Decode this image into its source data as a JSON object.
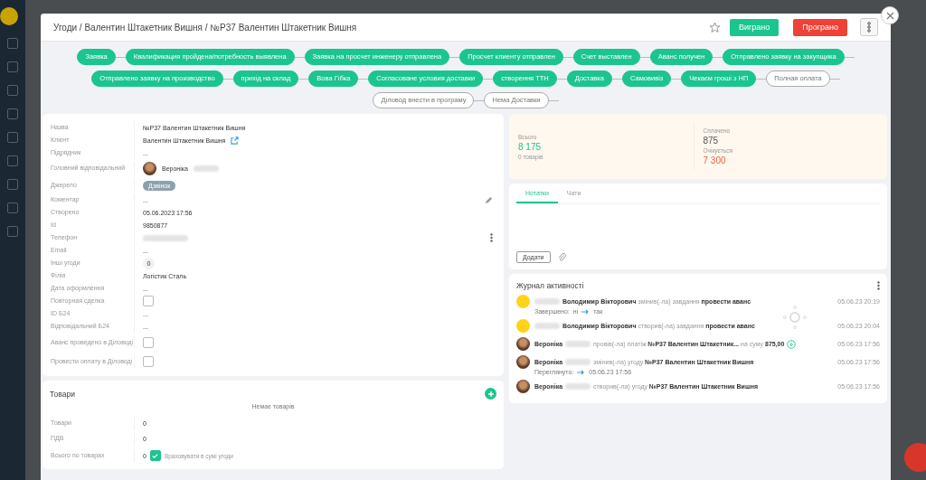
{
  "breadcrumb": "Угоди / Валентин Штакетник Вишня / №Р37 Валентин Штакетник Вишня",
  "header_buttons": [
    {
      "label": "Виграно",
      "kind": "won"
    },
    {
      "label": "Програно",
      "kind": "lost"
    }
  ],
  "stages": [
    {
      "label": "Заявка",
      "done": true
    },
    {
      "label": "Квалификация пройдена/потребность выявлена",
      "done": true
    },
    {
      "label": "Заявка на просчет инженеру отправлена",
      "done": true
    },
    {
      "label": "Просчет клиенту отправлен",
      "done": true
    },
    {
      "label": "Счет выставлен",
      "done": true
    },
    {
      "label": "Аванс получен",
      "done": true
    },
    {
      "label": "Отправлено заявку на закупщика",
      "done": true
    },
    {
      "label": "Отправлено заявку на производство",
      "done": true
    },
    {
      "label": "прихід на склад",
      "done": true
    },
    {
      "label": "Вова Гібка",
      "done": true
    },
    {
      "label": "Согласоване условия доставки",
      "done": true
    },
    {
      "label": "створення ТТН",
      "done": true
    },
    {
      "label": "Доставка",
      "done": true
    },
    {
      "label": "Самовивіз",
      "done": true
    },
    {
      "label": "Чекаєм гроші з НП",
      "done": true
    },
    {
      "label": "Полная оплата",
      "done": false
    },
    {
      "label": "Діловод внести в програму",
      "done": false
    },
    {
      "label": "Нема Доставки",
      "done": false
    }
  ],
  "fields": [
    {
      "label": "Назва",
      "kind": "text",
      "value": "№Р37 Валентин Штакетник Вишня"
    },
    {
      "label": "Клієнт",
      "kind": "link",
      "value": "Валентин Штакетник Вишня"
    },
    {
      "label": "Підрядник",
      "kind": "text",
      "value": "..."
    },
    {
      "label": "Головний відповідальний",
      "kind": "person",
      "value": "Вероніка"
    },
    {
      "label": "Джерело",
      "kind": "badge",
      "value": "Дзвінок"
    },
    {
      "label": "Коментар",
      "kind": "edit",
      "value": "..."
    },
    {
      "label": "Створено",
      "kind": "text",
      "value": "05.06.2023 17:56"
    },
    {
      "label": "Id",
      "kind": "text",
      "value": "9850877"
    },
    {
      "label": "Телефон",
      "kind": "phone"
    },
    {
      "label": "Email",
      "kind": "text",
      "value": "..."
    },
    {
      "label": "Інші угоди",
      "kind": "count",
      "value": "0"
    },
    {
      "label": "Філія",
      "kind": "text",
      "value": "Логістик Сталь"
    },
    {
      "label": "Дата оформлення",
      "kind": "text",
      "value": "..."
    },
    {
      "label": "Повторная сделка",
      "kind": "checkbox",
      "checked": false
    },
    {
      "label": "ID Б24",
      "kind": "text",
      "value": "..."
    },
    {
      "label": "Відповідальний Б24",
      "kind": "text",
      "value": "..."
    },
    {
      "label": "Аванс проведено в Діловоді",
      "kind": "checkbox",
      "checked": false
    },
    {
      "label": "Провести оплату в Діловоді",
      "kind": "checkbox",
      "checked": false
    }
  ],
  "products": {
    "title": "Товари",
    "empty": "Немає товарів",
    "summary": [
      {
        "label": "Товари",
        "value": "0"
      },
      {
        "label": "ПДВ",
        "value": "0"
      },
      {
        "label": "Всього по товарах",
        "value": "0",
        "checkbox": {
          "label": "Враховувати в сумі угоди",
          "checked": true
        }
      }
    ]
  },
  "totals": {
    "total_label": "Всього",
    "total": "8 175",
    "count": "0 товарів",
    "paid_label": "Сплачено",
    "paid": "875",
    "expected_label": "Очікується",
    "expected": "7 300"
  },
  "notes": {
    "tabs": [
      {
        "label": "Нотатки",
        "selected": true
      },
      {
        "label": "Чати",
        "selected": false
      }
    ],
    "add_button": "Додати"
  },
  "activity": {
    "title": "Журнал активності",
    "items": [
      {
        "kind": "initial",
        "text": "**Володимир Вікторович** змінив(-ла) завдання **провести аванс**",
        "time": "05.06.23 20:19",
        "detail": {
          "label": "Завершено:",
          "from": "ні",
          "to": "так"
        }
      },
      {
        "kind": "initial",
        "text": "**Володимир Вікторович** створив(-ла) завдання **провести аванс**",
        "time": "05.06.23 20:04"
      },
      {
        "kind": "photo",
        "name": "Вероніка",
        "text": "провів(-ла) платіж **№Р37 Валентин Штакетник...** на суму **875,00**",
        "time": "05.06.23 17:56",
        "download": true
      },
      {
        "kind": "photo",
        "name": "Вероніка",
        "text": "змінив(-ла) угоду **№Р37 Валентин Штакетник Вишня**",
        "time": "05.06.23 17:56",
        "detail": {
          "label": "Переглянуто:",
          "to": "05.06.23 17:56"
        }
      },
      {
        "kind": "photo",
        "name": "Вероніка",
        "text": "створив(-ла) угоду **№Р37 Валентин Штакетник Вишня**",
        "time": "05.06.23 17:56"
      }
    ]
  }
}
